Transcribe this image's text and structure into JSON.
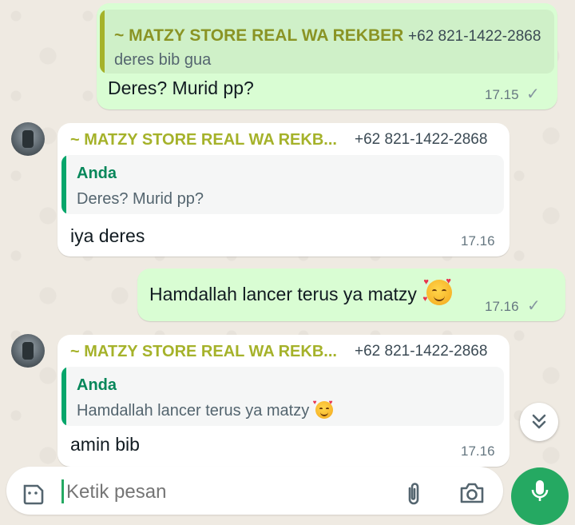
{
  "messages": [
    {
      "direction": "outgoing",
      "quote": {
        "sender": "~ MATZY STORE REAL WA REKBER",
        "phone": "+62 821-1422-2868",
        "text": "deres bib gua"
      },
      "text": "Deres? Murid pp?",
      "time": "17.15",
      "status": "✓"
    },
    {
      "direction": "incoming",
      "sender": "~ MATZY STORE REAL WA REKB...",
      "phone": "+62 821-1422-2868",
      "quote": {
        "sender": "Anda",
        "text": "Deres? Murid pp?"
      },
      "text": "iya deres",
      "time": "17.16"
    },
    {
      "direction": "outgoing",
      "text": "Hamdallah lancer terus ya matzy",
      "emoji": "smiling-face-with-hearts",
      "time": "17.16",
      "status": "✓"
    },
    {
      "direction": "incoming",
      "sender": "~ MATZY STORE REAL WA REKB...",
      "phone": "+62 821-1422-2868",
      "quote": {
        "sender": "Anda",
        "text": "Hamdallah lancer terus ya matzy",
        "emoji": "smiling-face-with-hearts"
      },
      "text": "amin bib",
      "time": "17.16"
    }
  ],
  "composer": {
    "placeholder": "Ketik pesan",
    "icons": [
      "sticker-icon",
      "attach-icon",
      "camera-icon",
      "mic-icon"
    ]
  },
  "scroll_down_icon": "double-chevron-down-icon",
  "colors": {
    "background": "#efeae2",
    "outgoing_bubble": "#d9fdd3",
    "incoming_bubble": "#ffffff",
    "sender_name": "#a5b22a",
    "quote_bar_self": "#06a66b",
    "quote_bar_other": "#a5b22a",
    "accent_green": "#25a962"
  }
}
